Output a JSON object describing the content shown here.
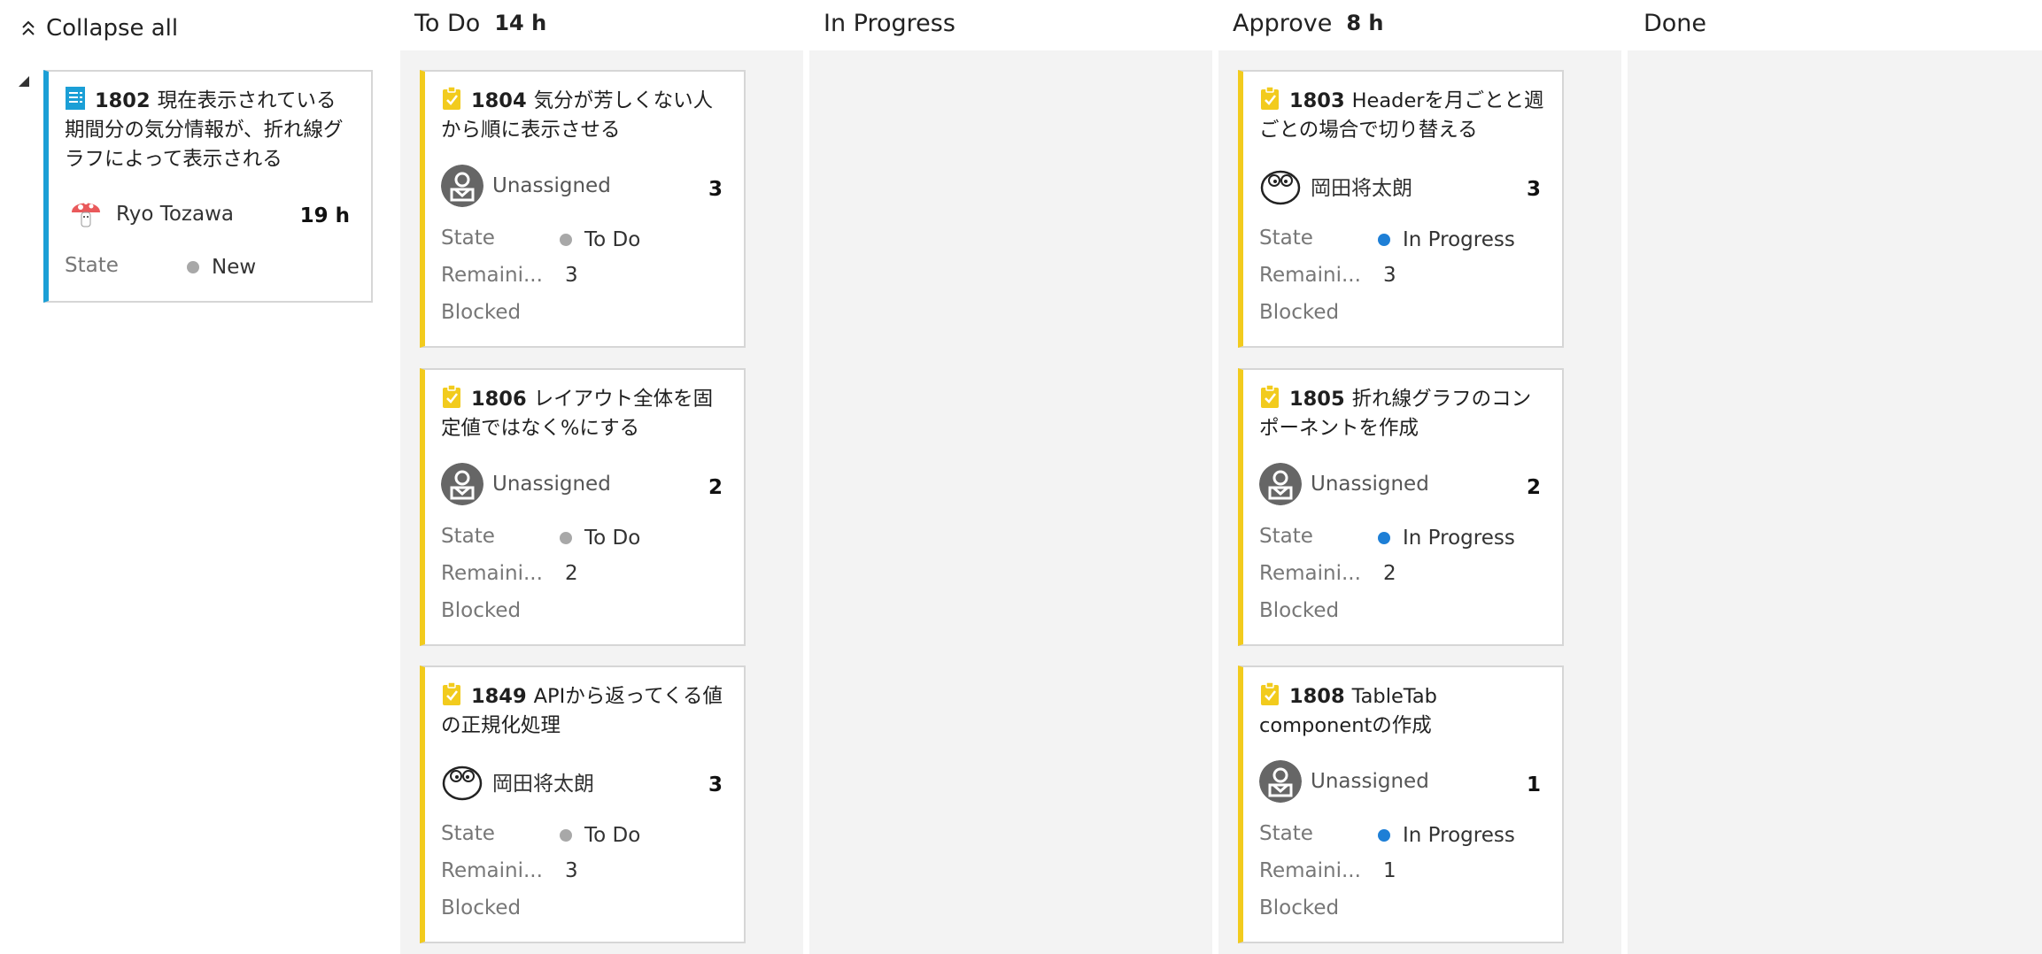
{
  "header": {
    "collapse_all": "Collapse all"
  },
  "columns": [
    {
      "name": "To Do",
      "hours": "14 h"
    },
    {
      "name": "In Progress",
      "hours": ""
    },
    {
      "name": "Approve",
      "hours": "8 h"
    },
    {
      "name": "Done",
      "hours": ""
    }
  ],
  "field_labels": {
    "state": "State",
    "remaining": "Remaini...",
    "blocked": "Blocked"
  },
  "parent": {
    "id": "1802",
    "title": "現在表示されている期間分の気分情報が、折れ線グラフによって表示される",
    "assignee": "Ryo Tozawa",
    "estimate": "19 h",
    "state": "New"
  },
  "cards": {
    "todo_1": {
      "id": "1804",
      "title": "気分が芳しくない人から順に表示させる",
      "assignee": "Unassigned",
      "estimate": "3",
      "state": "To Do",
      "remaining": "3"
    },
    "todo_2": {
      "id": "1806",
      "title": "レイアウト全体を固定値ではなく%にする",
      "assignee": "Unassigned",
      "estimate": "2",
      "state": "To Do",
      "remaining": "2"
    },
    "todo_3": {
      "id": "1849",
      "title": "APIから返ってくる値の正規化処理",
      "assignee": "岡田将太朗",
      "estimate": "3",
      "state": "To Do",
      "remaining": "3"
    },
    "approve_1": {
      "id": "1803",
      "title": "Headerを月ごとと週ごとの場合で切り替える",
      "assignee": "岡田将太朗",
      "estimate": "3",
      "state": "In Progress",
      "remaining": "3"
    },
    "approve_2": {
      "id": "1805",
      "title": "折れ線グラフのコンポーネントを作成",
      "assignee": "Unassigned",
      "estimate": "2",
      "state": "In Progress",
      "remaining": "2"
    },
    "approve_3": {
      "id": "1808",
      "title": "TableTab componentの作成",
      "assignee": "Unassigned",
      "estimate": "1",
      "state": "In Progress",
      "remaining": "1"
    }
  },
  "colors": {
    "task_bar": "#f2cb1d",
    "story_bar": "#1b9fd6",
    "state_todo": "#a8a8a8",
    "state_in_progress": "#1e7fd6"
  },
  "icons": {
    "collapse": "double-chevron-up-icon",
    "task": "clipboard-check-icon",
    "story": "document-icon",
    "unassigned": "unassigned-avatar-icon"
  }
}
